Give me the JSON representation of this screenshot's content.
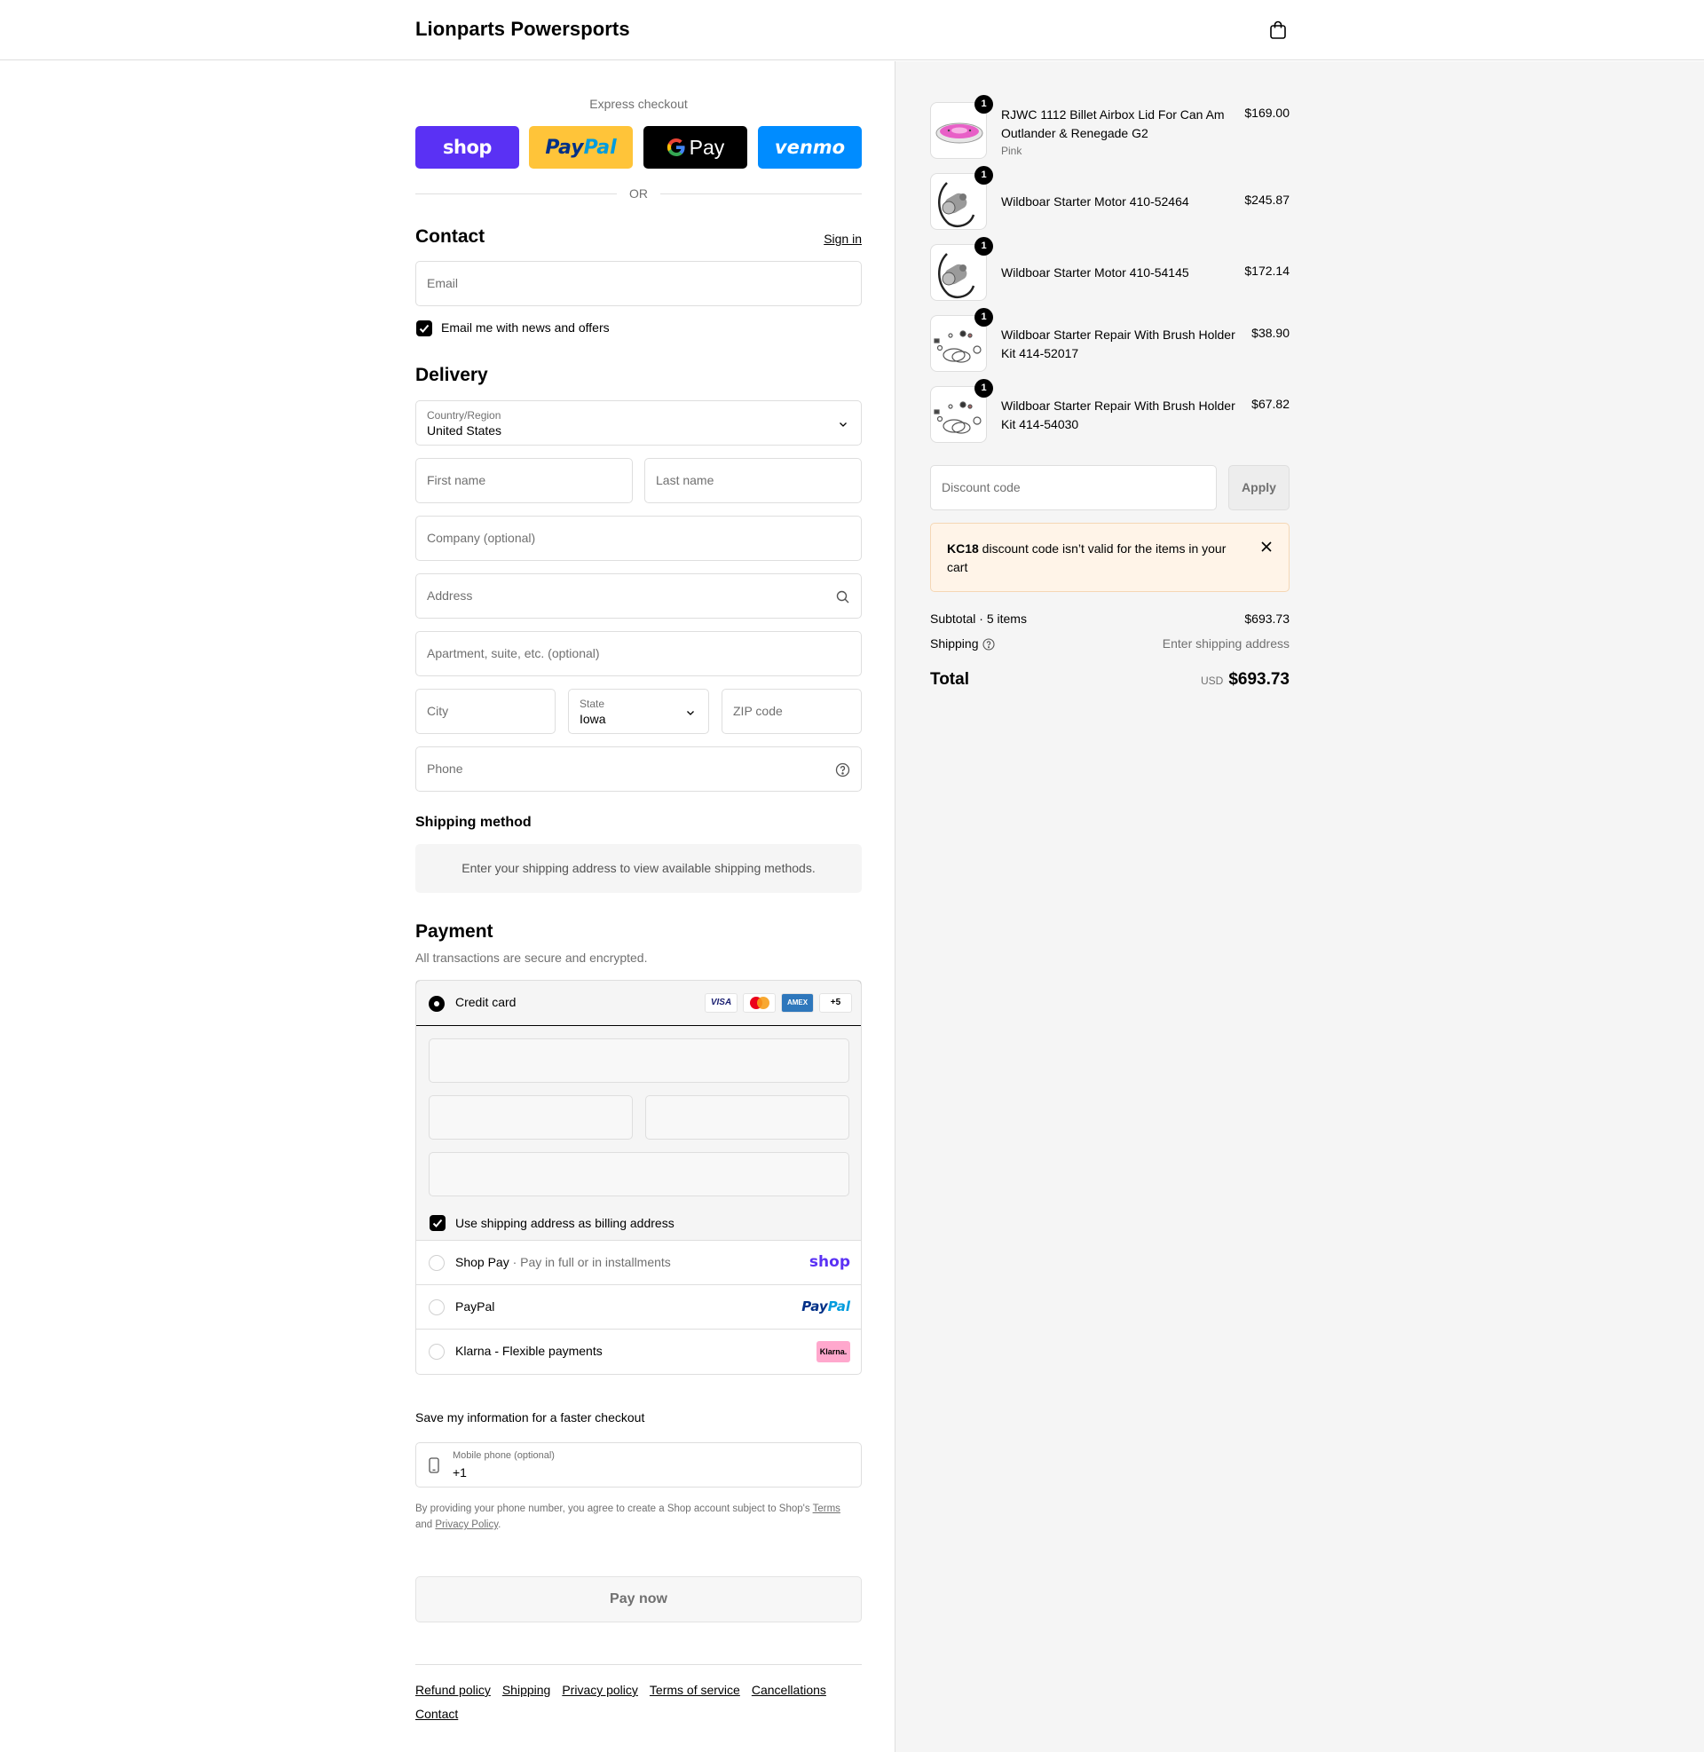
{
  "header": {
    "store_name": "Lionparts Powersports",
    "cart_icon": "shopping-bag-icon"
  },
  "express": {
    "label": "Express checkout",
    "buttons": {
      "shop": "shop",
      "paypal": "PayPal",
      "gpay": "Pay",
      "venmo": "venmo"
    },
    "or": "OR"
  },
  "contact": {
    "heading": "Contact",
    "sign_in": "Sign in",
    "email_placeholder": "Email",
    "news_checkbox_label": "Email me with news and offers",
    "news_checked": true
  },
  "delivery": {
    "heading": "Delivery",
    "country_label": "Country/Region",
    "country_value": "United States",
    "first_name": "First name",
    "last_name": "Last name",
    "company": "Company (optional)",
    "address": "Address",
    "apartment": "Apartment, suite, etc. (optional)",
    "city": "City",
    "state_label": "State",
    "state_value": "Iowa",
    "zip": "ZIP code",
    "phone": "Phone"
  },
  "shipping_method": {
    "heading": "Shipping method",
    "note": "Enter your shipping address to view available shipping methods."
  },
  "payment": {
    "heading": "Payment",
    "subtext": "All transactions are secure and encrypted.",
    "credit_card_label": "Credit card",
    "card_brands": [
      "VISA",
      "mastercard",
      "AMEX",
      "+5"
    ],
    "billing_checkbox_label": "Use shipping address as billing address",
    "billing_checked": true,
    "shop_pay_label": "Shop Pay",
    "shop_pay_sub": "Pay in full or in installments",
    "shop_pay_logo": "shop",
    "paypal_label": "PayPal",
    "paypal_logo": "PayPal",
    "klarna_label": "Klarna - Flexible payments",
    "klarna_logo": "Klarna."
  },
  "save_info": {
    "heading": "Save my information for a faster checkout",
    "mobile_label": "Mobile phone (optional)",
    "mobile_value": "+1",
    "fine_print_1": "By providing your phone number, you agree to create a Shop account subject to Shop's ",
    "terms": "Terms",
    "fine_print_2": "and ",
    "privacy": "Privacy Policy",
    "fine_print_3": "."
  },
  "pay_now": "Pay now",
  "footer_links": [
    "Refund policy",
    "Shipping",
    "Privacy policy",
    "Terms of service",
    "Cancellations",
    "Contact"
  ],
  "order": {
    "items": [
      {
        "name": "RJWC 1112 Billet Airbox Lid For Can Am Outlander & Renegade G2",
        "variant": "Pink",
        "price": "$169.00",
        "qty": "1"
      },
      {
        "name": "Wildboar Starter Motor 410-52464",
        "variant": "",
        "price": "$245.87",
        "qty": "1"
      },
      {
        "name": "Wildboar Starter Motor 410-54145",
        "variant": "",
        "price": "$172.14",
        "qty": "1"
      },
      {
        "name": "Wildboar Starter Repair With Brush Holder Kit 414-52017",
        "variant": "",
        "price": "$38.90",
        "qty": "1"
      },
      {
        "name": "Wildboar Starter Repair With Brush Holder Kit 414-54030",
        "variant": "",
        "price": "$67.82",
        "qty": "1"
      }
    ],
    "discount_placeholder": "Discount code",
    "apply": "Apply",
    "error_code": "KC18",
    "error_msg": " discount code isn’t valid for the items in your cart",
    "subtotal_label": "Subtotal · 5 items",
    "subtotal_value": "$693.73",
    "shipping_label": "Shipping",
    "shipping_value": "Enter shipping address",
    "total_label": "Total",
    "total_currency": "USD",
    "total_value": "$693.73"
  },
  "colors": {
    "shop_purple": "#5a31f4",
    "paypal_yellow": "#ffc439",
    "venmo_blue": "#008cff",
    "error_bg": "#fff4e8",
    "klarna_pink": "#ffa8cd"
  }
}
